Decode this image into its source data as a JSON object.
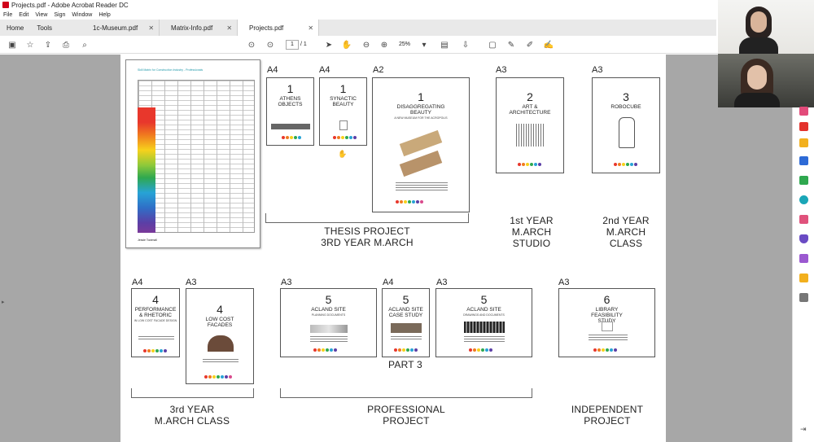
{
  "window": {
    "title": "Projects.pdf - Adobe Acrobat Reader DC"
  },
  "menu": [
    "File",
    "Edit",
    "View",
    "Sign",
    "Window",
    "Help"
  ],
  "nav_tabs": [
    "Home",
    "Tools"
  ],
  "doc_tabs": [
    {
      "label": "1c-Museum.pdf",
      "active": false
    },
    {
      "label": "Matrix-Info.pdf",
      "active": false
    },
    {
      "label": "Projects.pdf",
      "active": true
    }
  ],
  "toolbar": {
    "page_current": "1",
    "page_total": "/ 1",
    "zoom": "25%"
  },
  "sizes": {
    "athens": "A4",
    "beauty_small": "A4",
    "beauty_large": "A2",
    "art": "A3",
    "robocube": "A3",
    "performance": "A4",
    "facades": "A3",
    "acland1": "A3",
    "acland2": "A4",
    "acland3": "A3",
    "library": "A3"
  },
  "thumbs": {
    "athens": {
      "num": "1",
      "title": "ATHENS OBJECTS"
    },
    "beauty_small": {
      "num": "1",
      "title": "SYNACTIC BEAUTY"
    },
    "beauty_large": {
      "num": "1",
      "title": "DISAGGREGATING BEAUTY",
      "sub": "A NEW MUSEUM FOR THE ACROPOLIS"
    },
    "art": {
      "num": "2",
      "title": "ART & ARCHITECTURE"
    },
    "robocube": {
      "num": "3",
      "title": "ROBOCUBE"
    },
    "performance": {
      "num": "4",
      "title": "PERFORMANCE & RHETORIC",
      "sub": "IN LOW COST FACADE DESIGN"
    },
    "facades": {
      "num": "4",
      "title": "LOW COST FACADES"
    },
    "acland1": {
      "num": "5",
      "title": "ACLAND SITE",
      "sub": "PLANNING DOCUMENTS"
    },
    "acland2": {
      "num": "5",
      "title": "ACLAND SITE CASE STUDY"
    },
    "acland3": {
      "num": "5",
      "title": "ACLAND SITE",
      "sub": "DRAWINGS AND DOCUMENTS"
    },
    "library": {
      "num": "6",
      "title": "LIBRARY FEASIBILITY STUDY"
    }
  },
  "groups": {
    "thesis": "THESIS PROJECT\n3RD YEAR M.ARCH",
    "first_year": "1st YEAR\nM.ARCH\nSTUDIO",
    "second_year": "2nd YEAR\nM.ARCH\nCLASS",
    "part3": "PART 3",
    "third_year": "3rd YEAR\nM.ARCH CLASS",
    "professional": "PROFESSIONAL\nPROJECT",
    "independent": "INDEPENDENT\nPROJECT"
  },
  "matrix": {
    "header": "Skill Matrix for Construction Industry - Professionals",
    "footer": "Jessie Tootmall"
  },
  "colors": {
    "accent": "#d0021b",
    "viewer_bg": "#a7a7a7"
  },
  "dot_colors": [
    "#e8372c",
    "#f07a1f",
    "#f7d11c",
    "#2fa84f",
    "#27a3d6",
    "#5b3fa6",
    "#d94a8c"
  ]
}
